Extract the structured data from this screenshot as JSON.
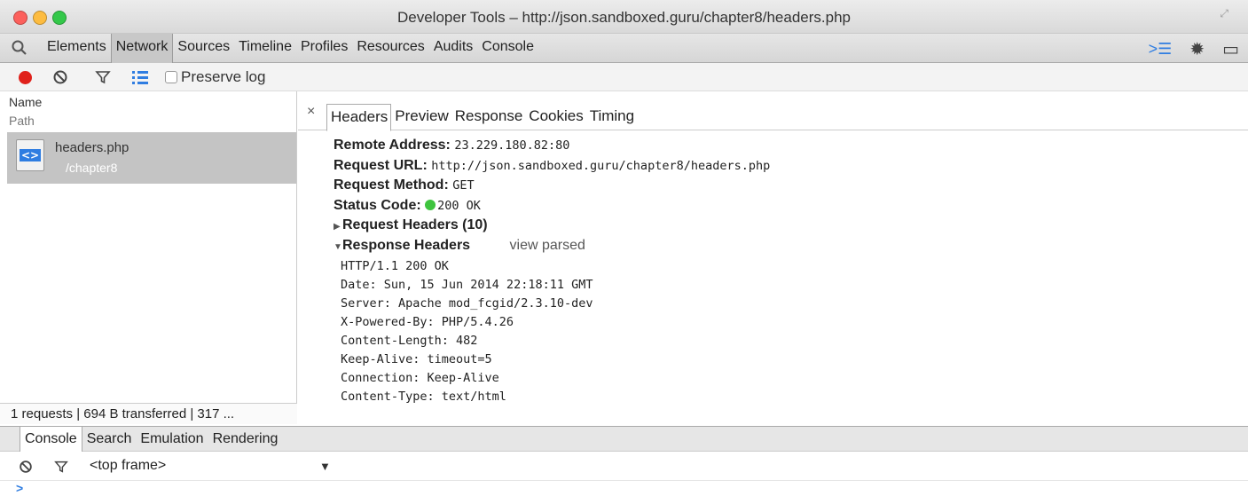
{
  "window": {
    "title": "Developer Tools – http://json.sandboxed.guru/chapter8/headers.php"
  },
  "main_tabs": [
    {
      "label": "Elements"
    },
    {
      "label": "Network",
      "active": true
    },
    {
      "label": "Sources"
    },
    {
      "label": "Timeline"
    },
    {
      "label": "Profiles"
    },
    {
      "label": "Resources"
    },
    {
      "label": "Audits"
    },
    {
      "label": "Console"
    }
  ],
  "network_toolbar": {
    "preserve_log_label": "Preserve log",
    "preserve_log_checked": false
  },
  "request_list": {
    "column_name": "Name",
    "column_path": "Path",
    "requests": [
      {
        "name": "headers.php",
        "path": "/chapter8",
        "icon": "html-file-icon"
      }
    ],
    "summary": "1 requests | 694 B transferred | 317 ..."
  },
  "detail_tabs": [
    {
      "label": "Headers",
      "active": true
    },
    {
      "label": "Preview"
    },
    {
      "label": "Response"
    },
    {
      "label": "Cookies"
    },
    {
      "label": "Timing"
    }
  ],
  "general": {
    "remote_address_key": "Remote Address:",
    "remote_address": "23.229.180.82:80",
    "request_url_key": "Request URL:",
    "request_url": "http://json.sandboxed.guru/chapter8/headers.php",
    "request_method_key": "Request Method:",
    "request_method": "GET",
    "status_code_key": "Status Code:",
    "status_code": "200 OK",
    "status_color": "#3ec43e"
  },
  "request_headers": {
    "label": "Request Headers (10)",
    "expanded": false
  },
  "response_headers": {
    "label": "Response Headers",
    "view_parsed": "view parsed",
    "expanded": true,
    "lines": [
      "HTTP/1.1 200 OK",
      "Date: Sun, 15 Jun 2014 22:18:11 GMT",
      "Server: Apache mod_fcgid/2.3.10-dev",
      "X-Powered-By: PHP/5.4.26",
      "Content-Length: 482",
      "Keep-Alive: timeout=5",
      "Connection: Keep-Alive",
      "Content-Type: text/html"
    ]
  },
  "drawer_tabs": [
    {
      "label": "Console",
      "active": true
    },
    {
      "label": "Search"
    },
    {
      "label": "Emulation"
    },
    {
      "label": "Rendering"
    }
  ],
  "console": {
    "frame_select": "<top frame>",
    "prompt": ">"
  },
  "colors": {
    "record": "#e0211b",
    "accent": "#2f7de1",
    "selected_row": "#c4c4c4"
  }
}
